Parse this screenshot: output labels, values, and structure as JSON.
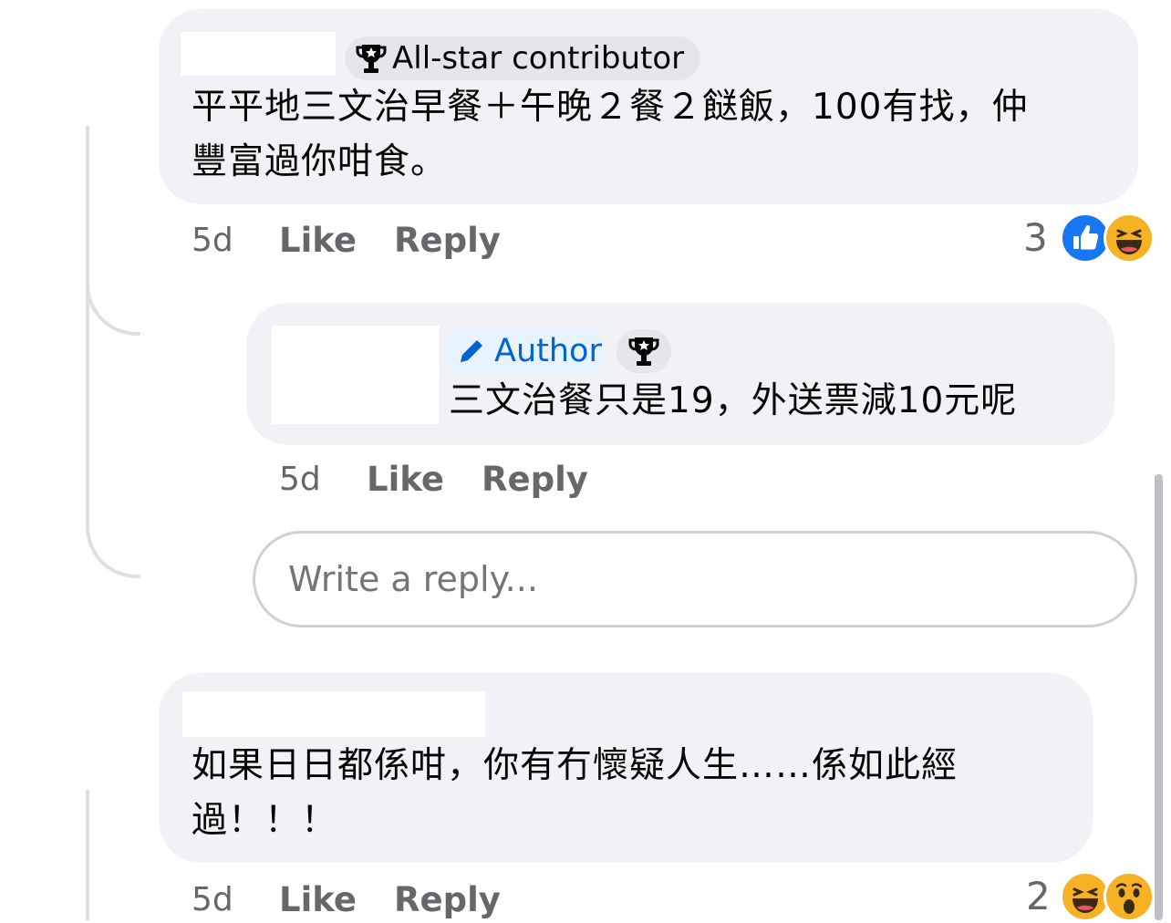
{
  "comments": [
    {
      "badge": "All-star contributor",
      "text_lines": [
        "平平地三文治早餐＋午晚２餐２餸飯，100有找，仲",
        "豐富過你咁食。"
      ],
      "time": "5d",
      "like_label": "Like",
      "reply_label": "Reply",
      "reaction_count": "3",
      "reactions": [
        "like-icon",
        "haha-icon"
      ]
    },
    {
      "author_badge": "Author",
      "text_lines": [
        "三文治餐只是19，外送票減10元呢"
      ],
      "time": "5d",
      "like_label": "Like",
      "reply_label": "Reply"
    },
    {
      "text_lines": [
        "如果日日都係咁，你有冇懷疑人生……係如此經",
        "過！！！"
      ],
      "time": "5d",
      "like_label": "Like",
      "reply_label": "Reply",
      "reaction_count": "2",
      "reactions": [
        "haha-icon",
        "wow-icon"
      ]
    }
  ],
  "reply_box": {
    "placeholder": "Write a reply..."
  },
  "colors": {
    "bubble": "#f0f2f5",
    "meta": "#65676b",
    "author_blue": "#0064d1",
    "like_blue": "#1877f2",
    "emoji_yellow": "#f7b125"
  }
}
